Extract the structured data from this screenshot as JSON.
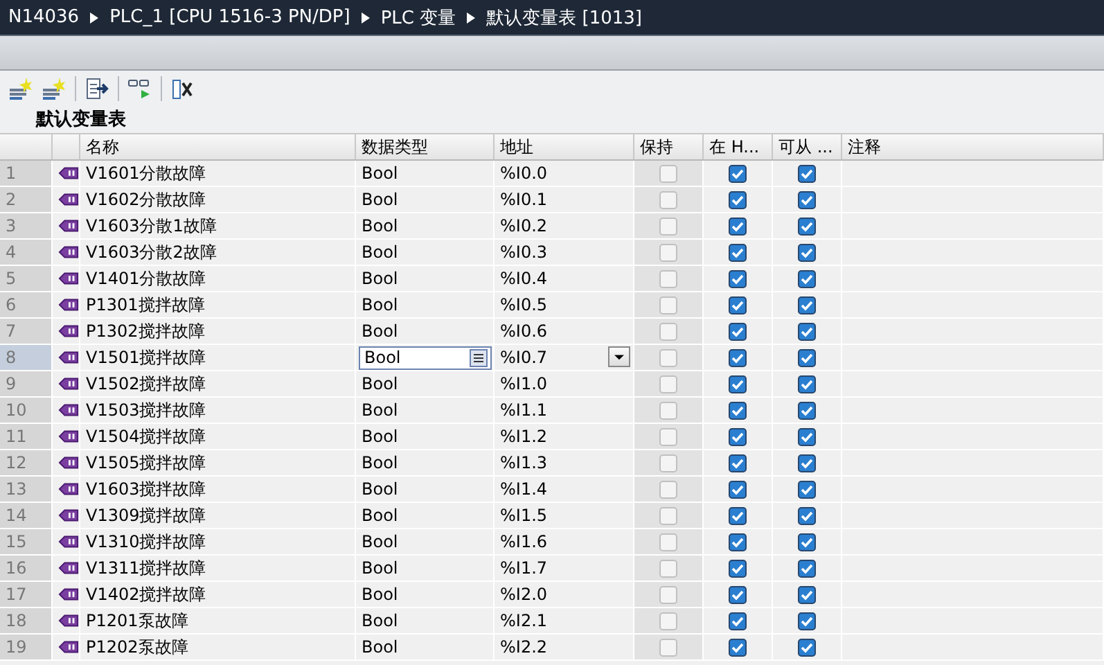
{
  "breadcrumb": [
    "N14036",
    "PLC_1 [CPU 1516-3 PN/DP]",
    "PLC 变量",
    "默认变量表 [1013]"
  ],
  "toolbar": [
    {
      "kind": "add"
    },
    {
      "kind": "insert"
    },
    {
      "kind": "export"
    },
    {
      "kind": "monitor"
    },
    {
      "kind": "delete"
    }
  ],
  "table_title": "默认变量表",
  "columns": [
    "名称",
    "数据类型",
    "地址",
    "保持",
    "在 H...",
    "可从 ...",
    "注释"
  ],
  "rows": [
    {
      "index": "1",
      "name": "V1601分散故障",
      "type": "Bool",
      "address": "%I0.0",
      "retain": false,
      "hmi_visible": true,
      "hmi_accessible": true,
      "selected": false
    },
    {
      "index": "2",
      "name": "V1602分散故障",
      "type": "Bool",
      "address": "%I0.1",
      "retain": false,
      "hmi_visible": true,
      "hmi_accessible": true,
      "selected": false
    },
    {
      "index": "3",
      "name": "V1603分散1故障",
      "type": "Bool",
      "address": "%I0.2",
      "retain": false,
      "hmi_visible": true,
      "hmi_accessible": true,
      "selected": false
    },
    {
      "index": "4",
      "name": "V1603分散2故障",
      "type": "Bool",
      "address": "%I0.3",
      "retain": false,
      "hmi_visible": true,
      "hmi_accessible": true,
      "selected": false
    },
    {
      "index": "5",
      "name": "V1401分散故障",
      "type": "Bool",
      "address": "%I0.4",
      "retain": false,
      "hmi_visible": true,
      "hmi_accessible": true,
      "selected": false
    },
    {
      "index": "6",
      "name": "P1301搅拌故障",
      "type": "Bool",
      "address": "%I0.5",
      "retain": false,
      "hmi_visible": true,
      "hmi_accessible": true,
      "selected": false
    },
    {
      "index": "7",
      "name": "P1302搅拌故障",
      "type": "Bool",
      "address": "%I0.6",
      "retain": false,
      "hmi_visible": true,
      "hmi_accessible": true,
      "selected": false
    },
    {
      "index": "8",
      "name": "V1501搅拌故障",
      "type": "Bool",
      "address": "%I0.7",
      "retain": false,
      "hmi_visible": true,
      "hmi_accessible": true,
      "selected": true
    },
    {
      "index": "9",
      "name": "V1502搅拌故障",
      "type": "Bool",
      "address": "%I1.0",
      "retain": false,
      "hmi_visible": true,
      "hmi_accessible": true,
      "selected": false
    },
    {
      "index": "10",
      "name": "V1503搅拌故障",
      "type": "Bool",
      "address": "%I1.1",
      "retain": false,
      "hmi_visible": true,
      "hmi_accessible": true,
      "selected": false
    },
    {
      "index": "11",
      "name": "V1504搅拌故障",
      "type": "Bool",
      "address": "%I1.2",
      "retain": false,
      "hmi_visible": true,
      "hmi_accessible": true,
      "selected": false
    },
    {
      "index": "12",
      "name": "V1505搅拌故障",
      "type": "Bool",
      "address": "%I1.3",
      "retain": false,
      "hmi_visible": true,
      "hmi_accessible": true,
      "selected": false
    },
    {
      "index": "13",
      "name": "V1603搅拌故障",
      "type": "Bool",
      "address": "%I1.4",
      "retain": false,
      "hmi_visible": true,
      "hmi_accessible": true,
      "selected": false
    },
    {
      "index": "14",
      "name": "V1309搅拌故障",
      "type": "Bool",
      "address": "%I1.5",
      "retain": false,
      "hmi_visible": true,
      "hmi_accessible": true,
      "selected": false
    },
    {
      "index": "15",
      "name": "V1310搅拌故障",
      "type": "Bool",
      "address": "%I1.6",
      "retain": false,
      "hmi_visible": true,
      "hmi_accessible": true,
      "selected": false
    },
    {
      "index": "16",
      "name": "V1311搅拌故障",
      "type": "Bool",
      "address": "%I1.7",
      "retain": false,
      "hmi_visible": true,
      "hmi_accessible": true,
      "selected": false
    },
    {
      "index": "17",
      "name": "V1402搅拌故障",
      "type": "Bool",
      "address": "%I2.0",
      "retain": false,
      "hmi_visible": true,
      "hmi_accessible": true,
      "selected": false
    },
    {
      "index": "18",
      "name": "P1201泵故障",
      "type": "Bool",
      "address": "%I2.1",
      "retain": false,
      "hmi_visible": true,
      "hmi_accessible": true,
      "selected": false
    },
    {
      "index": "19",
      "name": "P1202泵故障",
      "type": "Bool",
      "address": "%I2.2",
      "retain": false,
      "hmi_visible": true,
      "hmi_accessible": true,
      "selected": false
    }
  ]
}
